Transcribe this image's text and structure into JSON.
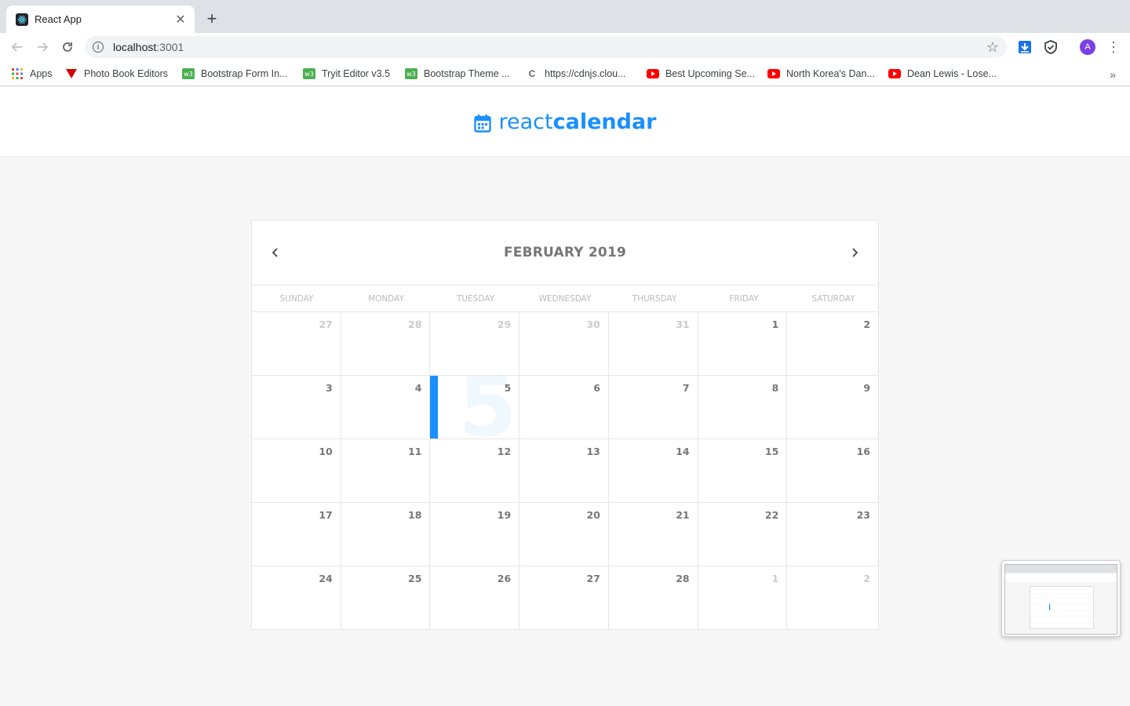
{
  "browser": {
    "tab_title": "React App",
    "url_host": "localhost",
    "url_port": ":3001",
    "avatar_letter": "A",
    "bookmarks": [
      {
        "label": "Apps",
        "icon": "apps-grid-icon"
      },
      {
        "label": "Photo Book Editors",
        "icon": "red-v-icon"
      },
      {
        "label": "Bootstrap Form In...",
        "icon": "green-w3-icon"
      },
      {
        "label": "Tryit Editor v3.5",
        "icon": "green-w3-icon"
      },
      {
        "label": "Bootstrap Theme ...",
        "icon": "green-w3-icon"
      },
      {
        "label": "https://cdnjs.clou...",
        "icon": "c-letter-icon"
      },
      {
        "label": "Best Upcoming Se...",
        "icon": "youtube-icon"
      },
      {
        "label": "North Korea's Dan...",
        "icon": "youtube-icon"
      },
      {
        "label": "Dean Lewis - Lose...",
        "icon": "youtube-icon"
      }
    ]
  },
  "app": {
    "logo_light": "react",
    "logo_bold": "calendar",
    "accent": "#1a8fff"
  },
  "calendar": {
    "month_label": "FEBRUARY 2019",
    "day_names": [
      "Sunday",
      "Monday",
      "Tuesday",
      "Wednesday",
      "Thursday",
      "Friday",
      "Saturday"
    ],
    "weeks": [
      [
        {
          "d": "27",
          "muted": true
        },
        {
          "d": "28",
          "muted": true
        },
        {
          "d": "29",
          "muted": true
        },
        {
          "d": "30",
          "muted": true
        },
        {
          "d": "31",
          "muted": true
        },
        {
          "d": "1"
        },
        {
          "d": "2"
        }
      ],
      [
        {
          "d": "3"
        },
        {
          "d": "4"
        },
        {
          "d": "5",
          "selected": true
        },
        {
          "d": "6"
        },
        {
          "d": "7"
        },
        {
          "d": "8"
        },
        {
          "d": "9"
        }
      ],
      [
        {
          "d": "10"
        },
        {
          "d": "11"
        },
        {
          "d": "12"
        },
        {
          "d": "13"
        },
        {
          "d": "14"
        },
        {
          "d": "15"
        },
        {
          "d": "16"
        }
      ],
      [
        {
          "d": "17"
        },
        {
          "d": "18"
        },
        {
          "d": "19"
        },
        {
          "d": "20"
        },
        {
          "d": "21"
        },
        {
          "d": "22"
        },
        {
          "d": "23"
        }
      ],
      [
        {
          "d": "24"
        },
        {
          "d": "25"
        },
        {
          "d": "26"
        },
        {
          "d": "27"
        },
        {
          "d": "28"
        },
        {
          "d": "1",
          "muted": true
        },
        {
          "d": "2",
          "muted": true
        }
      ]
    ]
  }
}
